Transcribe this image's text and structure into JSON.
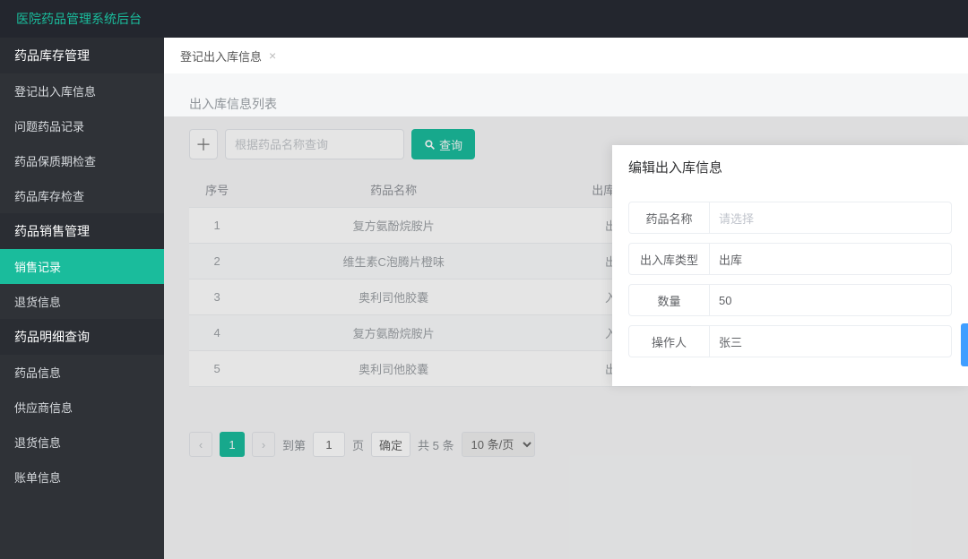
{
  "app": {
    "title": "医院药品管理系统后台"
  },
  "sidebar": {
    "groups": [
      {
        "label": "药品库存管理",
        "items": [
          {
            "label": "登记出入库信息"
          },
          {
            "label": "问题药品记录"
          },
          {
            "label": "药品保质期检查"
          },
          {
            "label": "药品库存检查"
          }
        ]
      },
      {
        "label": "药品销售管理",
        "items": [
          {
            "label": "销售记录"
          },
          {
            "label": "退货信息"
          }
        ]
      },
      {
        "label": "药品明细查询",
        "items": [
          {
            "label": "药品信息"
          },
          {
            "label": "供应商信息"
          },
          {
            "label": "退货信息"
          },
          {
            "label": "账单信息"
          }
        ]
      }
    ]
  },
  "tabs": [
    {
      "label": "登记出入库信息",
      "closable": true
    }
  ],
  "panel": {
    "title": "出入库信息列表",
    "add_icon": "＋",
    "search_placeholder": "根据药品名称查询",
    "query_label": "查询"
  },
  "table": {
    "columns": [
      "序号",
      "药品名称",
      "出库/入库"
    ],
    "rows": [
      {
        "idx": "1",
        "name": "复方氨酚烷胺片",
        "dir": "出库"
      },
      {
        "idx": "2",
        "name": "维生素C泡腾片橙味",
        "dir": "出库"
      },
      {
        "idx": "3",
        "name": "奥利司他胶囊",
        "dir": "入库"
      },
      {
        "idx": "4",
        "name": "复方氨酚烷胺片",
        "dir": "入库"
      },
      {
        "idx": "5",
        "name": "奥利司他胶囊",
        "dir": "出库"
      }
    ]
  },
  "pager": {
    "prev": "<",
    "next": ">",
    "current": "1",
    "jump_prefix": "到第",
    "jump_value": "1",
    "jump_suffix": "页",
    "confirm": "确定",
    "total": "共 5 条",
    "page_size": "10 条/页"
  },
  "modal": {
    "title": "编辑出入库信息",
    "fields": {
      "name": {
        "label": "药品名称",
        "value": "请选择",
        "placeholder": true
      },
      "type": {
        "label": "出入库类型",
        "value": "出库",
        "placeholder": false
      },
      "qty": {
        "label": "数量",
        "value": "50",
        "placeholder": false
      },
      "operator": {
        "label": "操作人",
        "value": "张三",
        "placeholder": false
      }
    }
  }
}
